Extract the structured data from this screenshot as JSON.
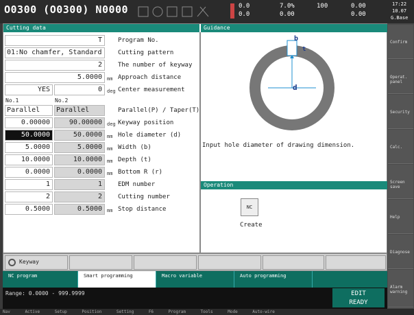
{
  "header": {
    "program": "O0300 (O0300) N0000",
    "status_x": "0.0",
    "status_z": "0.0",
    "feed": "7.0%",
    "spindle": "100",
    "axis1": "0.00",
    "axis2": "0.00",
    "time": "17:22",
    "date": "10.07",
    "mode": "G.Base"
  },
  "cutting": {
    "title": "Cutting data",
    "rows": [
      {
        "value": "T",
        "label": "Program No."
      },
      {
        "value": "01:No chamfer, Standard",
        "label": "Cutting pattern"
      },
      {
        "value": "2",
        "label": "The number of keyway"
      },
      {
        "value": "5.0000",
        "unit": "mm",
        "label": "Approach distance"
      },
      {
        "value": "YES",
        "value2": "0",
        "unit": "deg",
        "label": "Center measurement"
      }
    ],
    "no1": "No.1",
    "no2": "No.2",
    "rows2": [
      {
        "v1": "Parallel",
        "v2": "Parallel",
        "label": "Parallel(P) / Taper(T)"
      },
      {
        "v1": "0.00000",
        "v2": "90.00000",
        "unit": "deg",
        "label": "Keyway position"
      },
      {
        "v1": "50.0000",
        "v2": "50.0000",
        "unit": "mm",
        "label": "Hole diameter (d)"
      },
      {
        "v1": "5.0000",
        "v2": "5.0000",
        "unit": "mm",
        "label": "Width (b)"
      },
      {
        "v1": "10.0000",
        "v2": "10.0000",
        "unit": "mm",
        "label": "Depth (t)"
      },
      {
        "v1": "0.0000",
        "v2": "0.0000",
        "unit": "mm",
        "label": "Bottom R (r)"
      },
      {
        "v1": "1",
        "v2": "1",
        "label": "EDM number"
      },
      {
        "v1": "2",
        "v2": "2",
        "label": "Cutting number"
      },
      {
        "v1": "0.5000",
        "v2": "0.5000",
        "unit": "mm",
        "label": "Stop distance"
      }
    ]
  },
  "guidance": {
    "title": "Guidance",
    "text": "Input hole diameter of drawing dimension.",
    "label_b": "b",
    "label_t": "t",
    "label_d": "d"
  },
  "operation": {
    "title": "Operation",
    "create_label": "Create",
    "nc_icon": "NC"
  },
  "softkeys": [
    "Confirm",
    "Operat. panel",
    "Security",
    "Calc.",
    "Screen save",
    "Help",
    "Diagnose",
    "Alarm warning"
  ],
  "ops": {
    "keyway_label": "Keyway"
  },
  "tabs": [
    {
      "label": "NC program"
    },
    {
      "label": "Smart programming"
    },
    {
      "label": "Macro variable"
    },
    {
      "label": "Auto programming"
    }
  ],
  "msg": {
    "range": "Range: 0.0000 - 999.9999",
    "mode": "EDIT",
    "state": "READY"
  },
  "statusbar": "Nav Active Setup Position Setting F6 Program Tools Mode Auto-wire"
}
